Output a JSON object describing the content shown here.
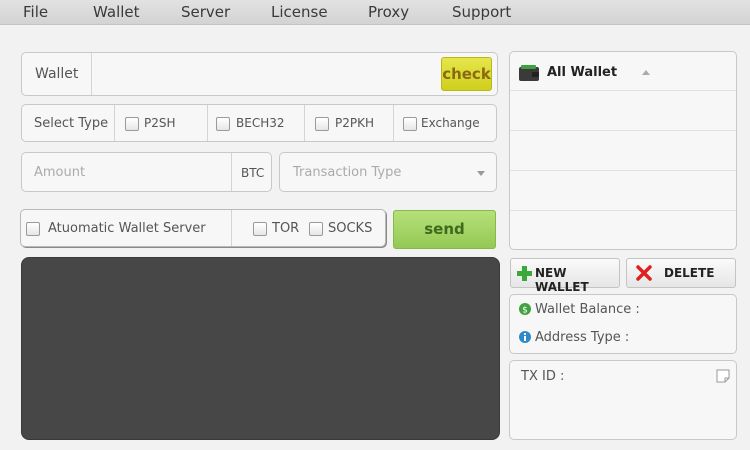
{
  "menu": {
    "file": "File",
    "wallet": "Wallet",
    "server": "Server",
    "license": "License",
    "proxy": "Proxy",
    "support": "Support"
  },
  "wallet_field": {
    "label": "Wallet",
    "value": "",
    "check_label": "check"
  },
  "select_type": {
    "label": "Select Type",
    "options": [
      "P2SH",
      "BECH32",
      "P2PKH",
      "Exchange"
    ]
  },
  "amount": {
    "placeholder": "Amount",
    "unit": "BTC"
  },
  "transaction_type": {
    "placeholder": "Transaction Type"
  },
  "server_options": {
    "auto_label": "Atuomatic Wallet Server",
    "tor_label": "TOR",
    "socks_label": "SOCKS"
  },
  "send_label": "send",
  "wallet_list": {
    "header": "All Wallet"
  },
  "buttons": {
    "new_wallet": "NEW WALLET",
    "delete": "DELETE"
  },
  "info": {
    "balance_label": "Wallet Balance :",
    "address_type_label": "Address Type :"
  },
  "tx": {
    "label": "TX ID :"
  },
  "colors": {
    "check": "#dcdc34",
    "send": "#a5d566",
    "console": "#474747",
    "delete_icon": "#e02020",
    "add_icon": "#3aa83a"
  }
}
